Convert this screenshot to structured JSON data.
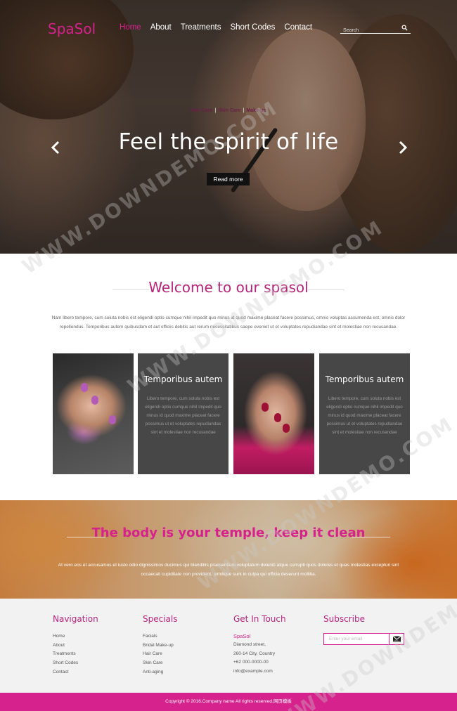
{
  "brand": {
    "logo": "SpaSol"
  },
  "nav": {
    "items": [
      "Home",
      "About",
      "Treatments",
      "Short Codes",
      "Contact"
    ],
    "active_index": 0
  },
  "search": {
    "placeholder": "Search"
  },
  "hero": {
    "tags": [
      "Hair Care",
      "Skin Care",
      "Make-up"
    ],
    "tag_separator": "|",
    "title": "Feel the spirit of life",
    "button": "Read more"
  },
  "welcome": {
    "title": "Welcome to our spasol",
    "text": "Nam libero tempore, cum soluta nobis est eligendi optio cumque nihil impedit quo minus id quod maxime placeat facere possimus, omnis voluptas assumenda est, omnis dolor repellendus. Temporibus autem quibusdam et aut officiis debitis aut rerum necessitatibus saepe eveniet ut et voluptates repudiandae sint et molestiae non recusandae."
  },
  "cards": [
    {
      "title": "Temporibus autem",
      "text": "Libero tempore, cum soluta nobis est eligendi optio cumque nihil impedit quo minus id quod maxime placeat facere possimus ut et voluptates repudiandae sint et molestiae non recusandae"
    },
    {
      "title": "Temporibus autem",
      "text": "Libero tempore, cum soluta nobis est eligendi optio cumque nihil impedit quo minus id quod maxime placeat facere possimus ut et voluptates repudiandae sint et molestiae non recusandae"
    }
  ],
  "quote": {
    "title": "The body is your temple, keep it clean",
    "text": "At vero eos et accusamus et iusto odio dignissimos ducimus qui blanditiis praesentium voluptatum deleniti atque corrupti quos dolores et quas molestias excepturi sint occaecati cupiditate non provident, similique sunt in culpa qui officia deserunt mollitia."
  },
  "footer": {
    "navigation": {
      "heading": "Navigation",
      "links": [
        "Home",
        "About",
        "Treatments",
        "Short Codes",
        "Contact"
      ]
    },
    "specials": {
      "heading": "Specials",
      "links": [
        "Facials",
        "Bridal Make-up",
        "Hair Care",
        "Skin Care",
        "Anti-aging"
      ]
    },
    "contact": {
      "heading": "Get In Touch",
      "brand": "SpaSol",
      "lines": [
        "Diamond street,",
        "260-14 City, Country",
        "+62 000-0000-00",
        "info@example.com"
      ]
    },
    "subscribe": {
      "heading": "Subscribe",
      "placeholder": "Enter your email"
    },
    "copyright": "Copyright © 2016.Company name All rights reserved.网页模板"
  },
  "watermark": "WWW.DOWNDEMO.COM",
  "colors": {
    "accent": "#d6228d",
    "heading": "#b8247b",
    "card_bg": "#474747",
    "footer_bg": "#f2f2f2"
  }
}
